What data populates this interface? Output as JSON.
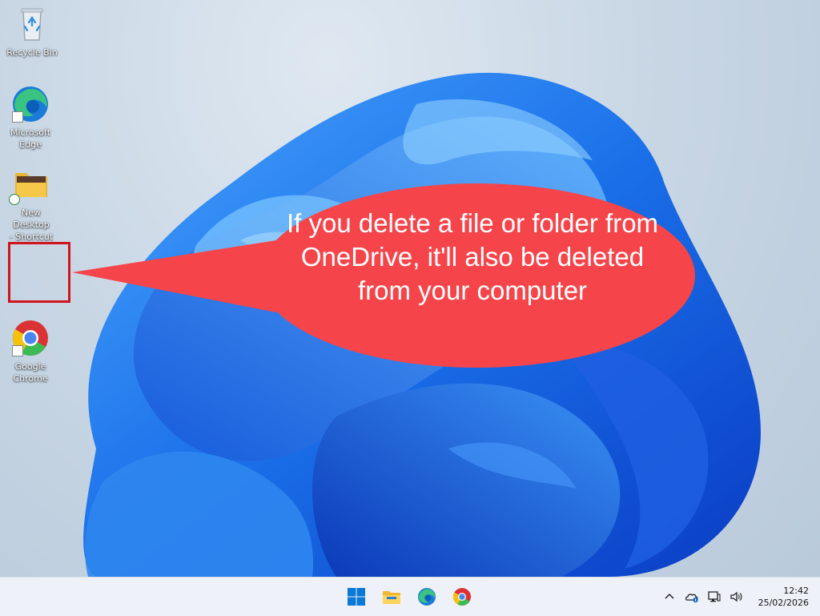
{
  "desktop_icons": [
    {
      "id": "recycle-bin",
      "label": "Recycle Bin",
      "icon": "recycle-bin-icon"
    },
    {
      "id": "microsoft-edge",
      "label_line1": "Microsoft",
      "label_line2": "Edge",
      "icon": "edge-icon"
    },
    {
      "id": "new-desktop-shortcut",
      "label_line1": "New Desktop",
      "label_line2": "- Shortcut",
      "icon": "folder-icon"
    },
    {
      "id": "google-chrome",
      "label_line1": "Google",
      "label_line2": "Chrome",
      "icon": "chrome-icon"
    }
  ],
  "callout": {
    "text": "If you delete a file or folder from OneDrive, it'll also be deleted from your computer",
    "color": "#f5454a"
  },
  "taskbar": {
    "apps": [
      "windows-start-icon",
      "file-explorer-icon",
      "edge-icon",
      "chrome-icon"
    ],
    "tray": [
      "chevron-up-icon",
      "onedrive-icon",
      "network-icon",
      "speaker-icon"
    ],
    "time": "12:42",
    "date": "25/02/2026"
  },
  "colors": {
    "accent": "#0067c0",
    "highlight_box": "#d0141e"
  }
}
